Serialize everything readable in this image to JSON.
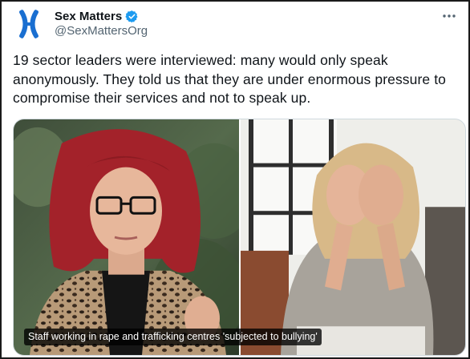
{
  "author": {
    "display_name": "Sex Matters",
    "handle": "@SexMattersOrg",
    "avatar_icon": "chromosome-x-logo-icon",
    "verified_icon": "verified-badge-icon"
  },
  "menu": {
    "icon": "more-dots-icon"
  },
  "tweet": {
    "text": "19 sector leaders were interviewed: many would only speak anonymously. They told us that they are under enormous pressure to compromise their services and not to speak up."
  },
  "media": {
    "caption": "Staff working in rape and trafficking centres 'subjected to bullying'",
    "left_image_icon": "photo-woman-portrait",
    "right_image_icon": "photo-woman-covering-face"
  },
  "colors": {
    "brand_blue": "#1a6fd1",
    "verified_blue": "#1d9bf0",
    "handle_gray": "#536471"
  }
}
